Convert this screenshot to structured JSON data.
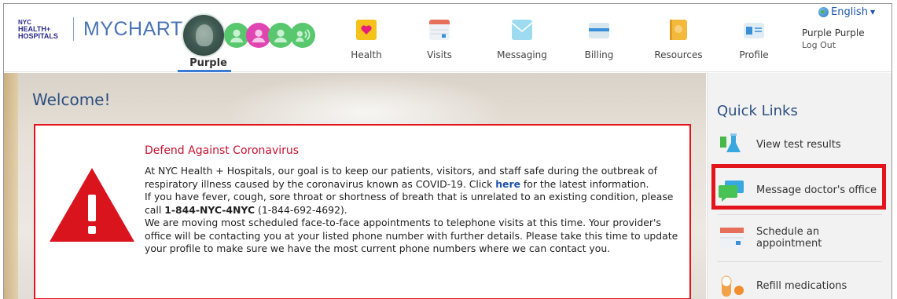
{
  "header": {
    "logo_nyc_line1": "NYC",
    "logo_nyc_line2": "HEALTH+",
    "logo_nyc_line3": "HOSPITALS",
    "logo_app": "MYCHART",
    "active_patient": "Purple",
    "nav": [
      {
        "label": "Health",
        "icon": "heart-folder-icon"
      },
      {
        "label": "Visits",
        "icon": "calendar-icon"
      },
      {
        "label": "Messaging",
        "icon": "envelope-icon"
      },
      {
        "label": "Billing",
        "icon": "credit-card-icon"
      },
      {
        "label": "Resources",
        "icon": "book-icon"
      },
      {
        "label": "Profile",
        "icon": "id-card-icon"
      }
    ],
    "language": "English",
    "user_name": "Purple Purple",
    "logout": "Log Out"
  },
  "main": {
    "welcome": "Welcome!",
    "alert": {
      "title": "Defend Against Coronavirus",
      "p1_before": "At NYC Health + Hospitals, our goal is to keep our patients, visitors, and staff safe during the outbreak of respiratory illness caused by the coronavirus known as COVID-19. Click ",
      "p1_link": "here",
      "p1_after": " for the latest information.",
      "p2_before": "If you have fever, cough, sore throat or shortness of breath that is unrelated to an existing condition, please call ",
      "p2_phone": "1-844-NYC-4NYC",
      "p2_after": " (1-844-692-4692).",
      "p3": "We are moving most scheduled face-to-face appointments to telephone visits at this time. Your provider's office will be contacting you at your listed phone number with further details. Please take this time to update your profile to make sure we have the most current phone numbers where we can contact you."
    }
  },
  "sidebar": {
    "title": "Quick Links",
    "items": [
      {
        "label": "View test results",
        "icon": "test-tubes-icon"
      },
      {
        "label": "Message doctor's office",
        "icon": "chat-bubbles-icon"
      },
      {
        "label": "Schedule an appointment",
        "icon": "calendar-icon"
      },
      {
        "label": "Refill medications",
        "icon": "pill-icon"
      }
    ]
  },
  "colors": {
    "brand_blue": "#4a74b4",
    "alert_red": "#e4141c",
    "link_blue": "#1b52a8"
  }
}
